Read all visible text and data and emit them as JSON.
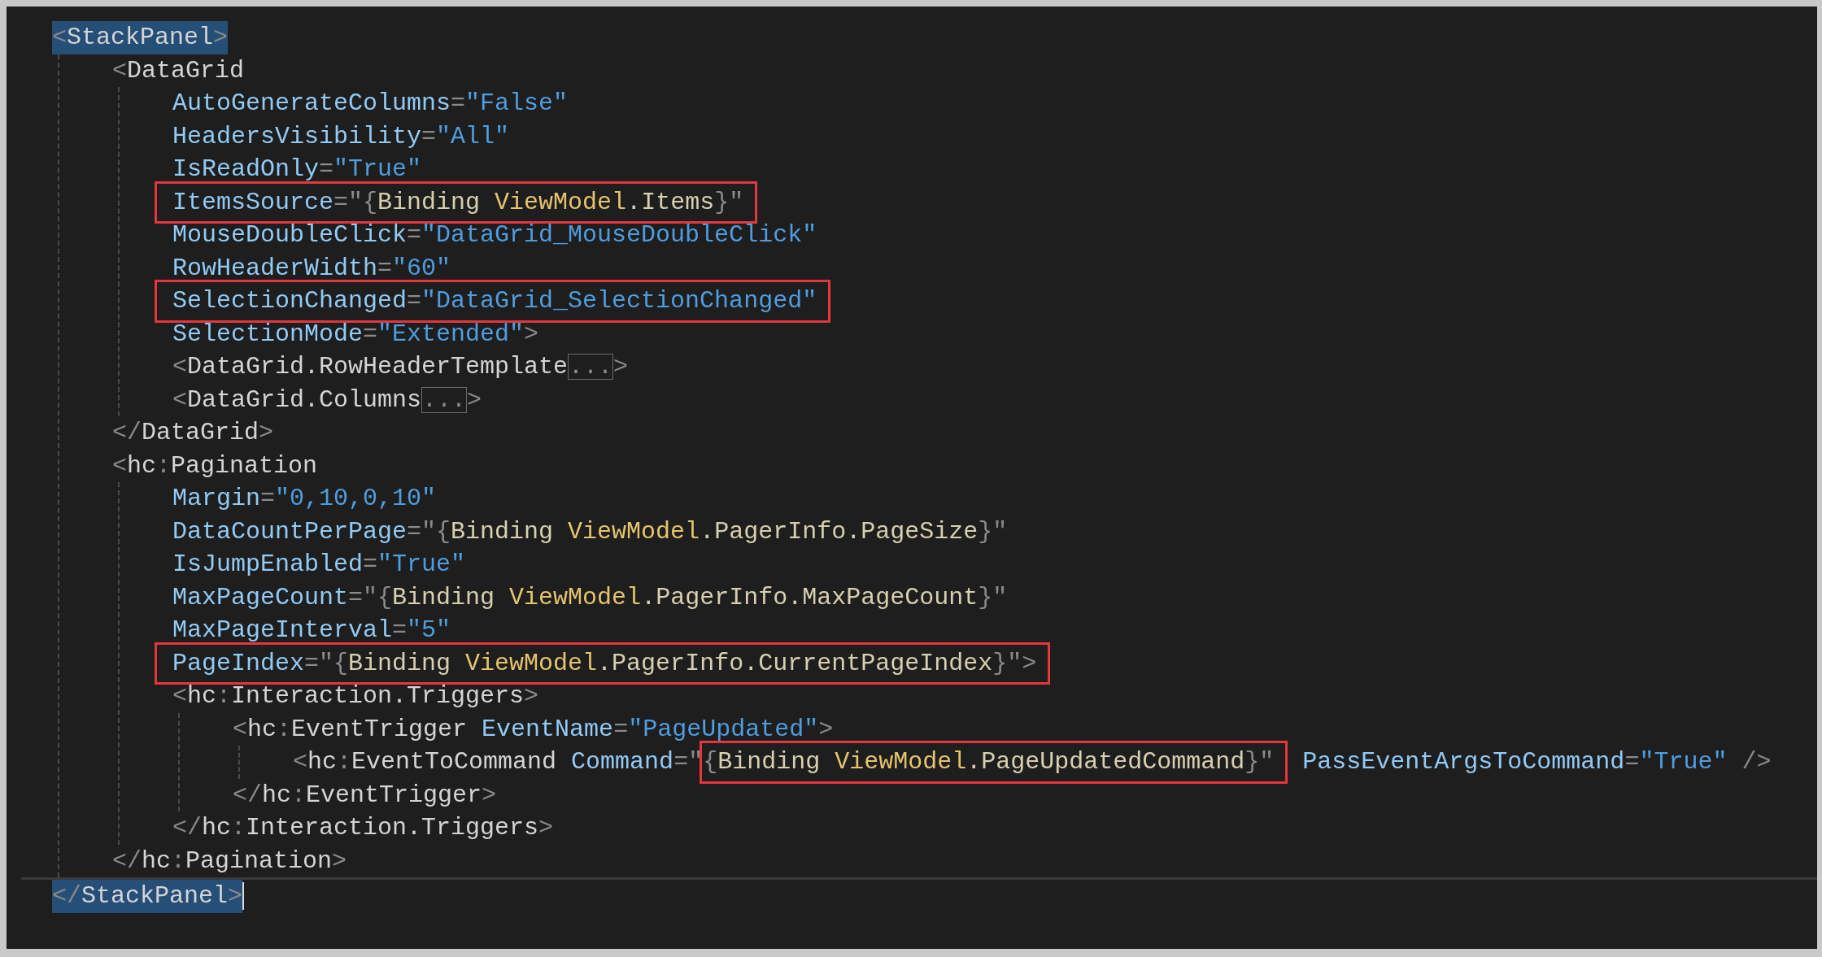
{
  "lines": [
    {
      "current": false,
      "segments": [
        {
          "kind": "matched",
          "tokens": [
            {
              "kind": "punct",
              "text": "<"
            },
            {
              "kind": "tag",
              "text": "StackPanel"
            },
            {
              "kind": "punct",
              "text": ">"
            }
          ]
        }
      ],
      "children": [
        {
          "segments": [
            {
              "kind": "code",
              "tokens": [
                {
                  "kind": "punct",
                  "text": "<"
                },
                {
                  "kind": "tag",
                  "text": "DataGrid"
                }
              ]
            }
          ],
          "children": [
            {
              "segments": [
                {
                  "kind": "code",
                  "tokens": [
                    {
                      "kind": "attr",
                      "text": "AutoGenerateColumns"
                    },
                    {
                      "kind": "punct",
                      "text": "="
                    },
                    {
                      "kind": "value",
                      "text": "\"False\""
                    }
                  ]
                }
              ]
            },
            {
              "segments": [
                {
                  "kind": "code",
                  "tokens": [
                    {
                      "kind": "attr",
                      "text": "HeadersVisibility"
                    },
                    {
                      "kind": "punct",
                      "text": "="
                    },
                    {
                      "kind": "value",
                      "text": "\"All\""
                    }
                  ]
                }
              ]
            },
            {
              "segments": [
                {
                  "kind": "code",
                  "tokens": [
                    {
                      "kind": "attr",
                      "text": "IsReadOnly"
                    },
                    {
                      "kind": "punct",
                      "text": "="
                    },
                    {
                      "kind": "value",
                      "text": "\"True\""
                    }
                  ]
                }
              ]
            },
            {
              "segments": [
                {
                  "kind": "boxed",
                  "tokens": [
                    {
                      "kind": "attr",
                      "text": "ItemsSource"
                    },
                    {
                      "kind": "punct",
                      "text": "=\"{"
                    },
                    {
                      "kind": "keyword",
                      "text": "Binding"
                    },
                    {
                      "kind": "object",
                      "text": " ViewModel"
                    },
                    {
                      "kind": "member",
                      "text": ".Items"
                    },
                    {
                      "kind": "punct",
                      "text": "}\""
                    }
                  ]
                }
              ]
            },
            {
              "segments": [
                {
                  "kind": "code",
                  "tokens": [
                    {
                      "kind": "attr",
                      "text": "MouseDoubleClick"
                    },
                    {
                      "kind": "punct",
                      "text": "="
                    },
                    {
                      "kind": "value",
                      "text": "\"DataGrid_MouseDoubleClick\""
                    }
                  ]
                }
              ]
            },
            {
              "segments": [
                {
                  "kind": "code",
                  "tokens": [
                    {
                      "kind": "attr",
                      "text": "RowHeaderWidth"
                    },
                    {
                      "kind": "punct",
                      "text": "="
                    },
                    {
                      "kind": "value",
                      "text": "\"60\""
                    }
                  ]
                }
              ]
            },
            {
              "segments": [
                {
                  "kind": "boxed",
                  "tokens": [
                    {
                      "kind": "attr",
                      "text": "SelectionChanged"
                    },
                    {
                      "kind": "punct",
                      "text": "="
                    },
                    {
                      "kind": "value",
                      "text": "\"DataGrid_SelectionChanged\""
                    }
                  ]
                }
              ]
            },
            {
              "segments": [
                {
                  "kind": "code",
                  "tokens": [
                    {
                      "kind": "attr",
                      "text": "SelectionMode"
                    },
                    {
                      "kind": "punct",
                      "text": "="
                    },
                    {
                      "kind": "value",
                      "text": "\"Extended\""
                    },
                    {
                      "kind": "punct",
                      "text": ">"
                    }
                  ]
                }
              ]
            },
            {
              "segments": [
                {
                  "kind": "code",
                  "tokens": [
                    {
                      "kind": "punct",
                      "text": "<"
                    },
                    {
                      "kind": "tag",
                      "text": "DataGrid.RowHeaderTemplate"
                    }
                  ]
                },
                {
                  "kind": "fold",
                  "tokens": [
                    {
                      "kind": "punct",
                      "text": "..."
                    }
                  ]
                },
                {
                  "kind": "code",
                  "tokens": [
                    {
                      "kind": "punct",
                      "text": ">"
                    }
                  ]
                }
              ]
            },
            {
              "segments": [
                {
                  "kind": "code",
                  "tokens": [
                    {
                      "kind": "punct",
                      "text": "<"
                    },
                    {
                      "kind": "tag",
                      "text": "DataGrid.Columns"
                    }
                  ]
                },
                {
                  "kind": "fold",
                  "tokens": [
                    {
                      "kind": "punct",
                      "text": "..."
                    }
                  ]
                },
                {
                  "kind": "code",
                  "tokens": [
                    {
                      "kind": "punct",
                      "text": ">"
                    }
                  ]
                }
              ]
            }
          ]
        },
        {
          "segments": [
            {
              "kind": "code",
              "tokens": [
                {
                  "kind": "punct",
                  "text": "</"
                },
                {
                  "kind": "tag",
                  "text": "DataGrid"
                },
                {
                  "kind": "punct",
                  "text": ">"
                }
              ]
            }
          ]
        },
        {
          "segments": [
            {
              "kind": "code",
              "tokens": [
                {
                  "kind": "punct",
                  "text": "<"
                },
                {
                  "kind": "tag",
                  "text": "hc"
                },
                {
                  "kind": "punct",
                  "text": ":"
                },
                {
                  "kind": "tag",
                  "text": "Pagination"
                }
              ]
            }
          ],
          "children": [
            {
              "segments": [
                {
                  "kind": "code",
                  "tokens": [
                    {
                      "kind": "attr",
                      "text": "Margin"
                    },
                    {
                      "kind": "punct",
                      "text": "="
                    },
                    {
                      "kind": "value",
                      "text": "\"0,10,0,10\""
                    }
                  ]
                }
              ]
            },
            {
              "segments": [
                {
                  "kind": "code",
                  "tokens": [
                    {
                      "kind": "attr",
                      "text": "DataCountPerPage"
                    },
                    {
                      "kind": "punct",
                      "text": "=\"{"
                    },
                    {
                      "kind": "keyword",
                      "text": "Binding"
                    },
                    {
                      "kind": "object",
                      "text": " ViewModel"
                    },
                    {
                      "kind": "member",
                      "text": ".PagerInfo.PageSize"
                    },
                    {
                      "kind": "punct",
                      "text": "}\""
                    }
                  ]
                }
              ]
            },
            {
              "segments": [
                {
                  "kind": "code",
                  "tokens": [
                    {
                      "kind": "attr",
                      "text": "IsJumpEnabled"
                    },
                    {
                      "kind": "punct",
                      "text": "="
                    },
                    {
                      "kind": "value",
                      "text": "\"True\""
                    }
                  ]
                }
              ]
            },
            {
              "segments": [
                {
                  "kind": "code",
                  "tokens": [
                    {
                      "kind": "attr",
                      "text": "MaxPageCount"
                    },
                    {
                      "kind": "punct",
                      "text": "=\"{"
                    },
                    {
                      "kind": "keyword",
                      "text": "Binding"
                    },
                    {
                      "kind": "object",
                      "text": " ViewModel"
                    },
                    {
                      "kind": "member",
                      "text": ".PagerInfo.MaxPageCount"
                    },
                    {
                      "kind": "punct",
                      "text": "}\""
                    }
                  ]
                }
              ]
            },
            {
              "segments": [
                {
                  "kind": "code",
                  "tokens": [
                    {
                      "kind": "attr",
                      "text": "MaxPageInterval"
                    },
                    {
                      "kind": "punct",
                      "text": "="
                    },
                    {
                      "kind": "value",
                      "text": "\"5\""
                    }
                  ]
                }
              ]
            },
            {
              "segments": [
                {
                  "kind": "boxed",
                  "tokens": [
                    {
                      "kind": "attr",
                      "text": "PageIndex"
                    },
                    {
                      "kind": "punct",
                      "text": "=\"{"
                    },
                    {
                      "kind": "keyword",
                      "text": "Binding"
                    },
                    {
                      "kind": "object",
                      "text": " ViewModel"
                    },
                    {
                      "kind": "member",
                      "text": ".PagerInfo.CurrentPageIndex"
                    },
                    {
                      "kind": "punct",
                      "text": "}\">"
                    }
                  ]
                }
              ]
            },
            {
              "segments": [
                {
                  "kind": "code",
                  "tokens": [
                    {
                      "kind": "punct",
                      "text": "<"
                    },
                    {
                      "kind": "tag",
                      "text": "hc"
                    },
                    {
                      "kind": "punct",
                      "text": ":"
                    },
                    {
                      "kind": "tag",
                      "text": "Interaction.Triggers"
                    },
                    {
                      "kind": "punct",
                      "text": ">"
                    }
                  ]
                }
              ],
              "children": [
                {
                  "segments": [
                    {
                      "kind": "code",
                      "tokens": [
                        {
                          "kind": "punct",
                          "text": "<"
                        },
                        {
                          "kind": "tag",
                          "text": "hc"
                        },
                        {
                          "kind": "punct",
                          "text": ":"
                        },
                        {
                          "kind": "tag",
                          "text": "EventTrigger"
                        },
                        {
                          "kind": "attr",
                          "text": " EventName"
                        },
                        {
                          "kind": "punct",
                          "text": "="
                        },
                        {
                          "kind": "value",
                          "text": "\"PageUpdated\""
                        },
                        {
                          "kind": "punct",
                          "text": ">"
                        }
                      ]
                    }
                  ],
                  "children": [
                    {
                      "segments": [
                        {
                          "kind": "code",
                          "tokens": [
                            {
                              "kind": "punct",
                              "text": "<"
                            },
                            {
                              "kind": "tag",
                              "text": "hc"
                            },
                            {
                              "kind": "punct",
                              "text": ":"
                            },
                            {
                              "kind": "tag",
                              "text": "EventToCommand"
                            },
                            {
                              "kind": "attr",
                              "text": " Command"
                            },
                            {
                              "kind": "punct",
                              "text": "=\""
                            }
                          ]
                        },
                        {
                          "kind": "boxed",
                          "tokens": [
                            {
                              "kind": "punct",
                              "text": "{"
                            },
                            {
                              "kind": "keyword",
                              "text": "Binding"
                            },
                            {
                              "kind": "object",
                              "text": " ViewModel"
                            },
                            {
                              "kind": "member",
                              "text": ".PageUpdatedCommand"
                            },
                            {
                              "kind": "punct",
                              "text": "}\""
                            }
                          ]
                        },
                        {
                          "kind": "code",
                          "tokens": [
                            {
                              "kind": "attr",
                              "text": " PassEventArgsToCommand"
                            },
                            {
                              "kind": "punct",
                              "text": "="
                            },
                            {
                              "kind": "value",
                              "text": "\"True\""
                            },
                            {
                              "kind": "punct",
                              "text": " />"
                            }
                          ]
                        }
                      ]
                    }
                  ]
                },
                {
                  "segments": [
                    {
                      "kind": "code",
                      "tokens": [
                        {
                          "kind": "punct",
                          "text": "</"
                        },
                        {
                          "kind": "tag",
                          "text": "hc"
                        },
                        {
                          "kind": "punct",
                          "text": ":"
                        },
                        {
                          "kind": "tag",
                          "text": "EventTrigger"
                        },
                        {
                          "kind": "punct",
                          "text": ">"
                        }
                      ]
                    }
                  ]
                }
              ]
            },
            {
              "segments": [
                {
                  "kind": "code",
                  "tokens": [
                    {
                      "kind": "punct",
                      "text": "</"
                    },
                    {
                      "kind": "tag",
                      "text": "hc"
                    },
                    {
                      "kind": "punct",
                      "text": ":"
                    },
                    {
                      "kind": "tag",
                      "text": "Interaction.Triggers"
                    },
                    {
                      "kind": "punct",
                      "text": ">"
                    }
                  ]
                }
              ]
            }
          ]
        },
        {
          "segments": [
            {
              "kind": "code",
              "tokens": [
                {
                  "kind": "punct",
                  "text": "</"
                },
                {
                  "kind": "tag",
                  "text": "hc"
                },
                {
                  "kind": "punct",
                  "text": ":"
                },
                {
                  "kind": "tag",
                  "text": "Pagination"
                },
                {
                  "kind": "punct",
                  "text": ">"
                }
              ]
            }
          ]
        }
      ]
    },
    {
      "current": true,
      "segments": [
        {
          "kind": "matched",
          "tokens": [
            {
              "kind": "punct",
              "text": "</"
            },
            {
              "kind": "tag",
              "text": "StackPanel"
            },
            {
              "kind": "punct",
              "text": ">"
            }
          ]
        }
      ]
    }
  ]
}
